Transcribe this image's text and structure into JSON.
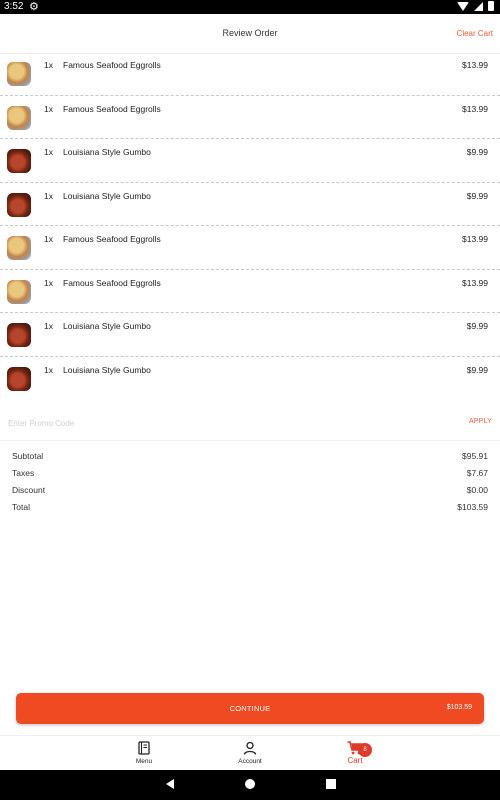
{
  "status_bar": {
    "time": "3:52"
  },
  "header": {
    "title": "Review Order",
    "clear_label": "Clear Cart"
  },
  "items": [
    {
      "qty": "1x",
      "name": "Famous Seafood Eggrolls",
      "price": "$13.99",
      "icon": "eggroll-thumbnail"
    },
    {
      "qty": "1x",
      "name": "Famous Seafood Eggrolls",
      "price": "$13.99",
      "icon": "eggroll-thumbnail"
    },
    {
      "qty": "1x",
      "name": "Louisiana Style Gumbo",
      "price": "$9.99",
      "icon": "gumbo-thumbnail"
    },
    {
      "qty": "1x",
      "name": "Louisiana Style Gumbo",
      "price": "$9.99",
      "icon": "gumbo-thumbnail"
    },
    {
      "qty": "1x",
      "name": "Famous Seafood Eggrolls",
      "price": "$13.99",
      "icon": "eggroll-thumbnail"
    },
    {
      "qty": "1x",
      "name": "Famous Seafood Eggrolls",
      "price": "$13.99",
      "icon": "eggroll-thumbnail"
    },
    {
      "qty": "1x",
      "name": "Louisiana Style Gumbo",
      "price": "$9.99",
      "icon": "gumbo-thumbnail"
    },
    {
      "qty": "1x",
      "name": "Louisiana Style Gumbo",
      "price": "$9.99",
      "icon": "gumbo-thumbnail"
    }
  ],
  "promo": {
    "placeholder": "Enter Promo Code",
    "value": "",
    "apply_label": "APPLY"
  },
  "totals": {
    "subtotal_label": "Subtotal",
    "subtotal": "$95.91",
    "taxes_label": "Taxes",
    "taxes": "$7.67",
    "discount_label": "Discount",
    "discount": "$0.00",
    "total_label": "Total",
    "total": "$103.59"
  },
  "continue_button": {
    "label": "CONTINUE",
    "amount": "$103.59"
  },
  "bottom_nav": {
    "menu_label": "Menu",
    "account_label": "Account",
    "cart_label": "Cart",
    "cart_badge": "8"
  },
  "colors": {
    "accent": "#f04a23",
    "cart_active": "#e23a2a"
  }
}
